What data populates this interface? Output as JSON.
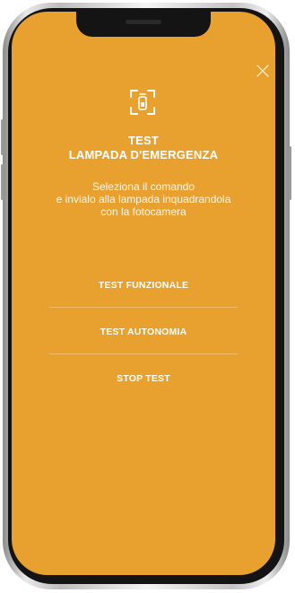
{
  "screen": {
    "background_color": "#e8a12f",
    "close_icon": "close-icon",
    "header_icon": "camera-scan-icon"
  },
  "title": {
    "line1": "TEST",
    "line2": "LAMPADA D'EMERGENZA"
  },
  "description": {
    "line1": "Seleziona il comando",
    "line2": "e invialo alla lampada inquadrandola",
    "line3": "con la fotocamera"
  },
  "commands": [
    {
      "label": "TEST FUNZIONALE"
    },
    {
      "label": "TEST AUTONOMIA"
    },
    {
      "label": "STOP TEST"
    }
  ]
}
